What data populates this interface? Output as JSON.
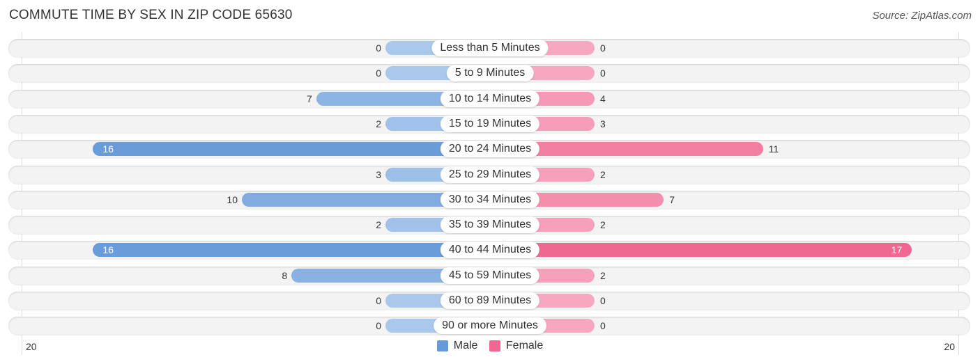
{
  "title": "COMMUTE TIME BY SEX IN ZIP CODE 65630",
  "source": "Source: ZipAtlas.com",
  "colors": {
    "male_dark": "#6699d8",
    "male_light": "#a9c8ec",
    "female_dark": "#f06891",
    "female_light": "#f7a8c1"
  },
  "chart_data": {
    "type": "bar",
    "orientation": "horizontal-diverging",
    "title": "COMMUTE TIME BY SEX IN ZIP CODE 65630",
    "categories": [
      "Less than 5 Minutes",
      "5 to 9 Minutes",
      "10 to 14 Minutes",
      "15 to 19 Minutes",
      "20 to 24 Minutes",
      "25 to 29 Minutes",
      "30 to 34 Minutes",
      "35 to 39 Minutes",
      "40 to 44 Minutes",
      "45 to 59 Minutes",
      "60 to 89 Minutes",
      "90 or more Minutes"
    ],
    "series": [
      {
        "name": "Male",
        "values": [
          0,
          0,
          7,
          2,
          16,
          3,
          10,
          2,
          16,
          8,
          0,
          0
        ]
      },
      {
        "name": "Female",
        "values": [
          0,
          0,
          4,
          3,
          11,
          2,
          7,
          2,
          17,
          2,
          0,
          0
        ]
      }
    ],
    "axis": {
      "left_label": "20",
      "right_label": "20",
      "range": [
        -20,
        20
      ]
    },
    "legend": [
      "Male",
      "Female"
    ],
    "legend_position": "bottom-center"
  }
}
